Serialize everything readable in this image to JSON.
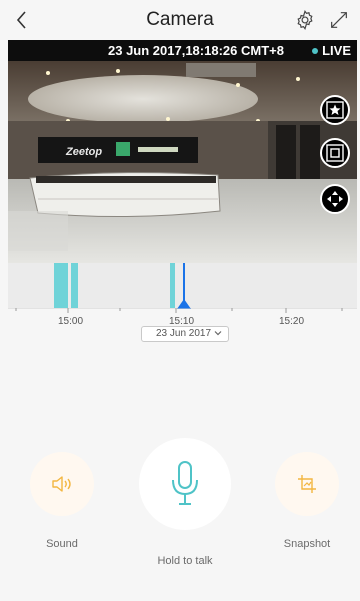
{
  "header": {
    "title": "Camera",
    "back_icon": "chevron-left-icon",
    "settings_icon": "gear-icon",
    "fullscreen_icon": "expand-arrows-icon"
  },
  "video": {
    "timestamp": "23 Jun 2017,18:18:26 CMT+8",
    "live_label": "LIVE",
    "live_dot_color": "#4fc3c7",
    "sign_brand": "Zeetop",
    "controls": [
      "star-bookmark-icon",
      "record-icon",
      "pan-tilt-icon"
    ]
  },
  "timeline": {
    "tick_labels": [
      "15:00",
      "15:10",
      "15:20"
    ],
    "selected_date": "23 Jun 2017",
    "recording_color": "#6fd3d8",
    "needle_color": "#1a73e8"
  },
  "actions": {
    "sound_label": "Sound",
    "talk_label": "Hold to talk",
    "snapshot_label": "Snapshot",
    "accent_color": "#f3b640",
    "mic_color": "#4fc3c7"
  }
}
